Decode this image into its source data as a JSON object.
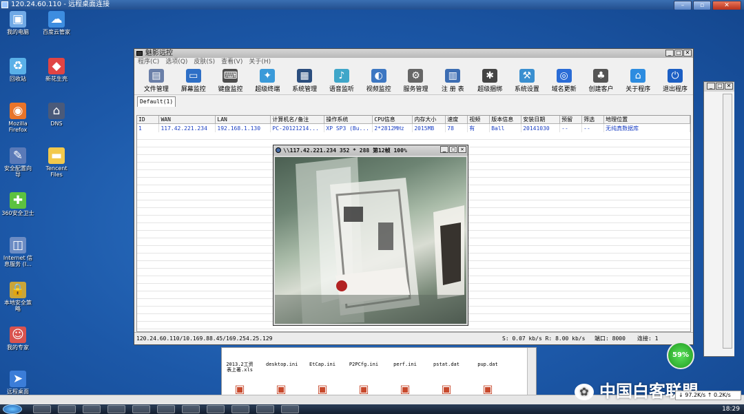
{
  "remote_session": {
    "title": "120.24.60.110 - 远程桌面连接"
  },
  "desktop_icons": [
    {
      "label": "我的电脑",
      "icon": "computer-icon",
      "color": "#6fa9e6",
      "glyph": "▣"
    },
    {
      "label": "百度云管家",
      "icon": "baidu-cloud-icon",
      "color": "#3d8de0",
      "glyph": "☁"
    },
    {
      "label": "回收站",
      "icon": "recycle-bin-icon",
      "color": "#5ab0e8",
      "glyph": "♻"
    },
    {
      "label": "新花生壳",
      "icon": "peanut-shell-icon",
      "color": "#e04444",
      "glyph": "◆"
    },
    {
      "label": "Mozilla\nFirefox",
      "icon": "firefox-icon",
      "color": "#e8742a",
      "glyph": "◉"
    },
    {
      "label": "DNS",
      "icon": "dns-icon",
      "color": "#4a5a7a",
      "glyph": "⌂"
    },
    {
      "label": "安全配置向\n导",
      "icon": "security-wizard-icon",
      "color": "#5a7ab8",
      "glyph": "✎"
    },
    {
      "label": "Tencent\nFiles",
      "icon": "folder-icon",
      "color": "#f2c94c",
      "glyph": "▬"
    },
    {
      "label": "360安全卫士",
      "icon": "360-security-icon",
      "color": "#5cc240",
      "glyph": "✚"
    },
    {
      "label": "Internet 信\n息服务 (I...",
      "icon": "iis-icon",
      "color": "#6c8cc4",
      "glyph": "◫"
    },
    {
      "label": "本地安全策\n略",
      "icon": "local-policy-icon",
      "color": "#c9a53a",
      "glyph": "🔒"
    },
    {
      "label": "我的专家",
      "icon": "expert-icon",
      "color": "#d9534f",
      "glyph": "☺"
    },
    {
      "label": "远程桌面\n连接",
      "icon": "remote-desktop-icon",
      "color": "#3b7dd8",
      "glyph": "➤"
    }
  ],
  "app": {
    "title": "魅影远控",
    "menu": [
      "程序(C)",
      "选项(Q)",
      "皮肤(S)",
      "查看(V)",
      "关于(H)"
    ],
    "toolbar": [
      {
        "label": "文件管理",
        "icon": "file-manager-icon",
        "color": "#6a7fa8",
        "glyph": "▤"
      },
      {
        "label": "屏幕监控",
        "icon": "screen-monitor-icon",
        "color": "#2e6fc6",
        "glyph": "▭"
      },
      {
        "label": "键盘监控",
        "icon": "keyboard-icon",
        "color": "#4d4d4d",
        "glyph": "⌨"
      },
      {
        "label": "超级终端",
        "icon": "terminal-icon",
        "color": "#3a9ad9",
        "glyph": "✦"
      },
      {
        "label": "系统管理",
        "icon": "system-manager-icon",
        "color": "#2b4e7e",
        "glyph": "▦"
      },
      {
        "label": "语音监听",
        "icon": "audio-monitor-icon",
        "color": "#3fa6c9",
        "glyph": "♪"
      },
      {
        "label": "视频监控",
        "icon": "video-monitor-icon",
        "color": "#3d77c2",
        "glyph": "◐"
      },
      {
        "label": "服务管理",
        "icon": "service-manager-icon",
        "color": "#666666",
        "glyph": "⚙"
      },
      {
        "label": "注 册 表",
        "icon": "registry-icon",
        "color": "#3c6db3",
        "glyph": "▥"
      },
      {
        "label": "超级捆绑",
        "icon": "bundle-icon",
        "color": "#444444",
        "glyph": "✱"
      },
      {
        "label": "系统设置",
        "icon": "settings-icon",
        "color": "#3a8fd0",
        "glyph": "⚒"
      },
      {
        "label": "域名更新",
        "icon": "domain-update-icon",
        "color": "#2a6cd6",
        "glyph": "◎"
      },
      {
        "label": "创建客户",
        "icon": "create-client-icon",
        "color": "#555555",
        "glyph": "♣"
      },
      {
        "label": "关于程序",
        "icon": "about-icon",
        "color": "#2d8ce0",
        "glyph": "⌂"
      },
      {
        "label": "退出程序",
        "icon": "exit-icon",
        "color": "#1c5fc4",
        "glyph": "⏻"
      }
    ],
    "tab": "Default(1)",
    "columns": [
      "ID",
      "WAN",
      "LAN",
      "计算机名/备注",
      "操作系统",
      "CPU信息",
      "内存大小",
      "速度",
      "视频",
      "版本信息",
      "安装日期",
      "预留",
      "筛选",
      "地理位置"
    ],
    "rows": [
      [
        "1",
        "117.42.221.234",
        "192.168.1.130",
        "PC-20121214...",
        "XP SP3 (Bu...",
        "2*2812MHz",
        "2015MB",
        "78",
        "有",
        "Ball",
        "20141030",
        "--",
        "--",
        "无纯真数据库"
      ]
    ],
    "status": {
      "left": "120.24.60.110/10.169.88.45/169.254.25.129",
      "speed": "S: 0.07 kb/s R: 8.00 kb/s",
      "port": "端口: 8000",
      "conn": "连接: 1"
    }
  },
  "webcam": {
    "title": "\\\\117.42.221.234 352 * 288 第12帧 100%"
  },
  "explorer": {
    "files": [
      "2013.2工资\n表上著.xls",
      "desktop.ini",
      "EtCap.ini",
      "P2PCfg.ini",
      "perf.ini",
      "pstat.dat",
      "pup.dat"
    ]
  },
  "tray": {
    "net_percent": "59%",
    "net_speed": "↓ 97.2K/s  ↑ 0.2K/s",
    "clock": "18:29"
  },
  "watermark": "中国白客联盟"
}
